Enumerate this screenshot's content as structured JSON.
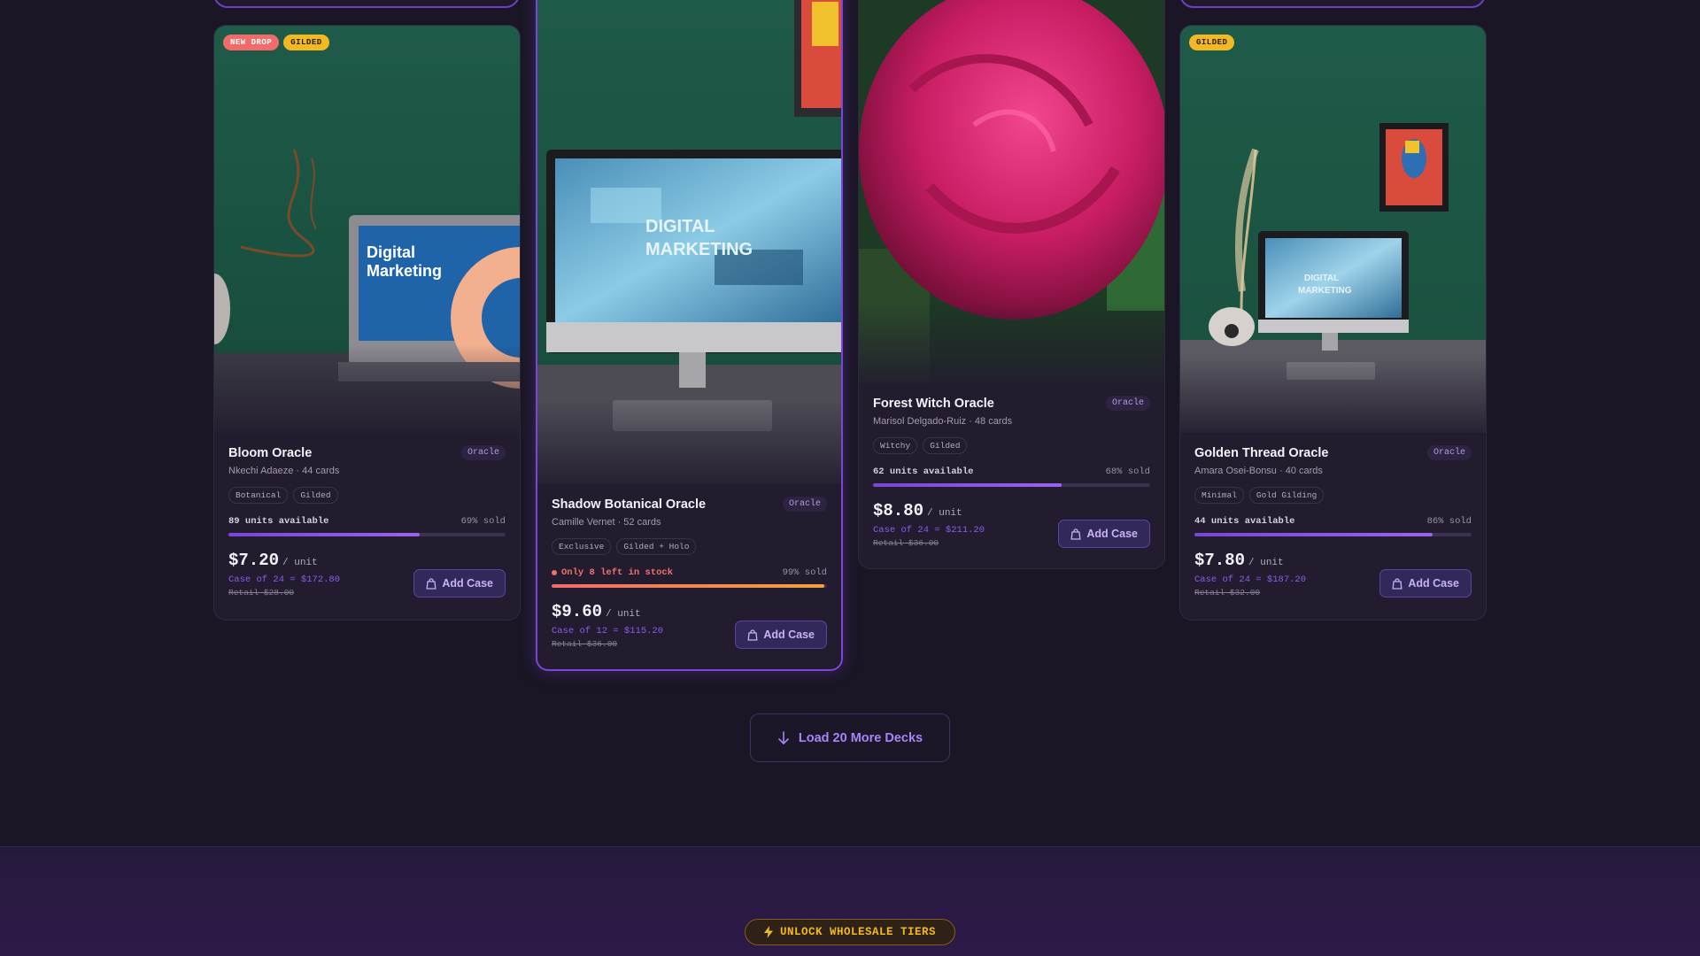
{
  "cards": [
    {
      "badges": [
        "NEW DROP",
        "GILDED"
      ],
      "title": "Bloom Oracle",
      "type": "Oracle",
      "meta": "Nkechi Adaeze · 44 cards",
      "tags": [
        "Botanical",
        "Gilded"
      ],
      "stock_label": "89 units available",
      "sold_label": "69% sold",
      "sold_fraction": 0.69,
      "price": "$7.20",
      "unit": "/ unit",
      "case": "Case of 24 = $172.80",
      "retail": "Retail $28.00",
      "add_label": "Add Case"
    },
    {
      "title": "Shadow Botanical Oracle",
      "type": "Oracle",
      "meta": "Camille Vernet · 52 cards",
      "tags": [
        "Exclusive",
        "Gilded + Holo"
      ],
      "stock_label": "Only 8 left in stock",
      "sold_label": "99% sold",
      "sold_fraction": 0.99,
      "price": "$9.60",
      "unit": "/ unit",
      "case": "Case of 12 = $115.20",
      "retail": "Retail $36.00",
      "add_label": "Add Case"
    },
    {
      "title": "Forest Witch Oracle",
      "type": "Oracle",
      "meta": "Marisol Delgado-Ruiz · 48 cards",
      "tags": [
        "Witchy",
        "Gilded"
      ],
      "stock_label": "62 units available",
      "sold_label": "68% sold",
      "sold_fraction": 0.68,
      "price": "$8.80",
      "unit": "/ unit",
      "case": "Case of 24 = $211.20",
      "retail": "Retail $36.00",
      "add_label": "Add Case"
    },
    {
      "badges": [
        "GILDED"
      ],
      "title": "Golden Thread Oracle",
      "type": "Oracle",
      "meta": "Amara Osei-Bonsu · 40 cards",
      "tags": [
        "Minimal",
        "Gold Gilding"
      ],
      "stock_label": "44 units available",
      "sold_label": "86% sold",
      "sold_fraction": 0.86,
      "price": "$7.80",
      "unit": "/ unit",
      "case": "Case of 24 = $187.20",
      "retail": "Retail $32.00",
      "add_label": "Add Case"
    }
  ],
  "load_more": {
    "label": "Load 20 More Decks",
    "icon": "arrow-down-icon"
  },
  "promo": {
    "label": "UNLOCK WHOLESALE TIERS",
    "icon": "lightning-icon"
  },
  "colors": {
    "accent": "#8b5cf0",
    "gold": "#f2b925",
    "alert": "#f07070",
    "background": "#1a1625"
  }
}
